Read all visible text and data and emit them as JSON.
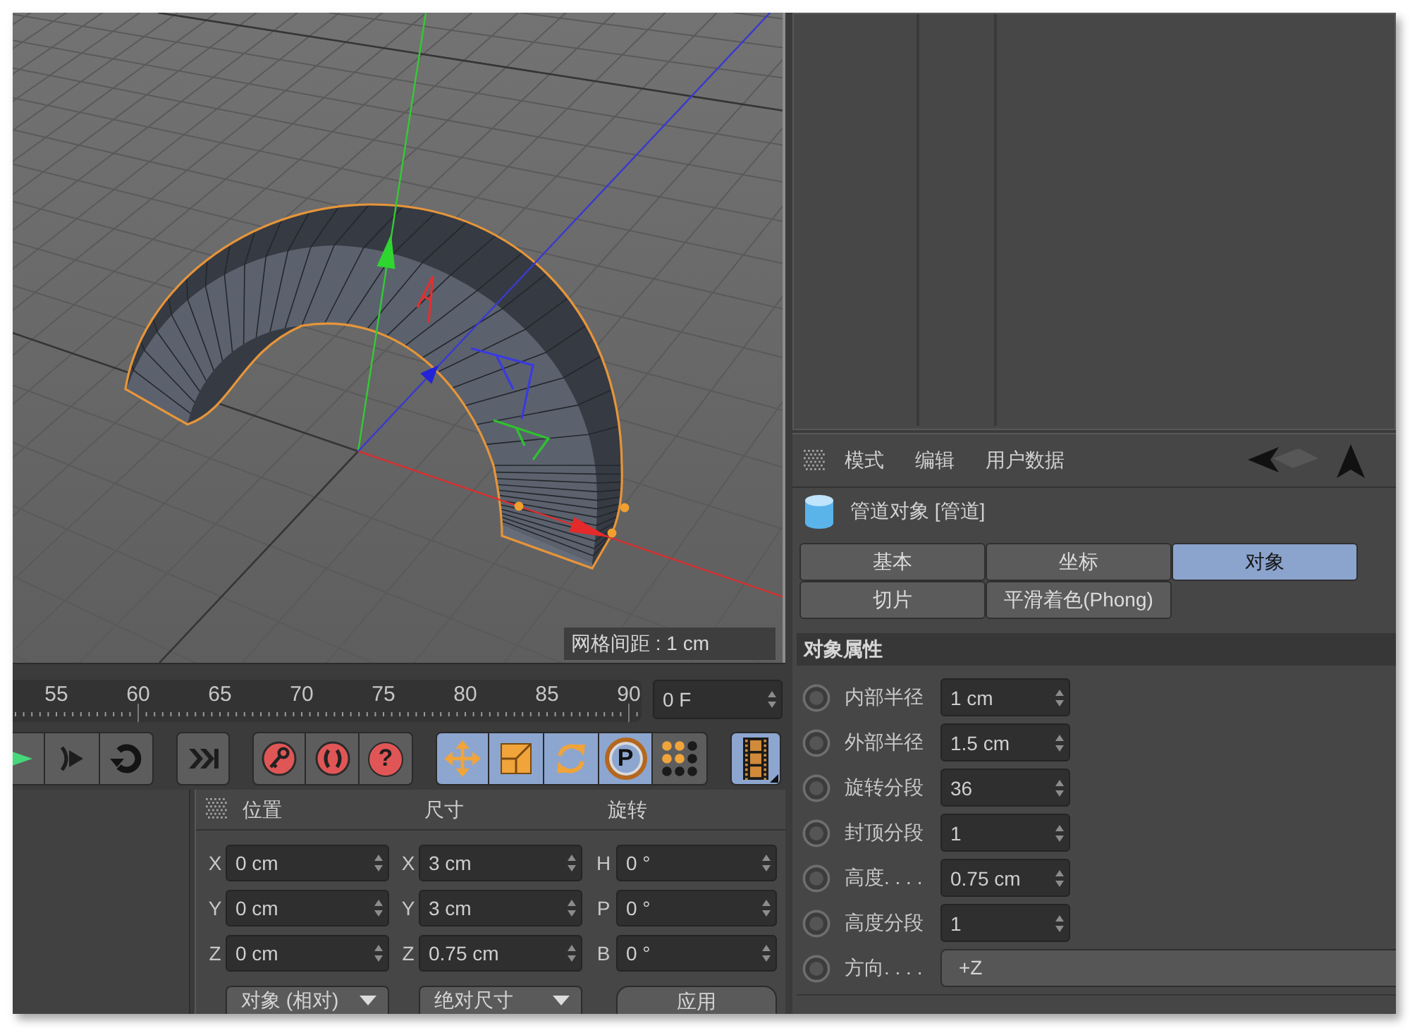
{
  "viewport": {
    "grid_label": "网格间距 : 1 cm"
  },
  "timeline": {
    "ruler_labels": [
      "55",
      "60",
      "65",
      "70",
      "75",
      "80",
      "85",
      "90"
    ],
    "frame": "0 F"
  },
  "toolbar": [
    {
      "buttons": [
        {
          "kind": "play",
          "active": false
        },
        {
          "kind": "next-frame",
          "active": false
        },
        {
          "kind": "loop",
          "active": false
        }
      ]
    },
    {
      "buttons": [
        {
          "kind": "go-to-end",
          "active": false
        }
      ]
    },
    {
      "buttons": [
        {
          "kind": "record",
          "active": false
        },
        {
          "kind": "autokey",
          "active": false
        },
        {
          "kind": "help",
          "active": false,
          "glyph": "?"
        }
      ]
    },
    {
      "buttons": [
        {
          "kind": "move",
          "active": true
        },
        {
          "kind": "scale",
          "active": true
        },
        {
          "kind": "rotate",
          "active": true
        },
        {
          "kind": "parameter",
          "active": true,
          "glyph": "P"
        },
        {
          "kind": "points",
          "active": false
        }
      ]
    },
    {
      "buttons": [
        {
          "kind": "film",
          "active": true
        }
      ]
    }
  ],
  "coordinates": {
    "headers": [
      "位置",
      "尺寸",
      "旋转"
    ],
    "rows": [
      {
        "cells": [
          {
            "axis": "X",
            "value": "0 cm"
          },
          {
            "axis": "X",
            "value": "3 cm"
          },
          {
            "axis": "H",
            "value": "0 °"
          }
        ]
      },
      {
        "cells": [
          {
            "axis": "Y",
            "value": "0 cm"
          },
          {
            "axis": "Y",
            "value": "3 cm"
          },
          {
            "axis": "P",
            "value": "0 °"
          }
        ]
      },
      {
        "cells": [
          {
            "axis": "Z",
            "value": "0 cm"
          },
          {
            "axis": "Z",
            "value": "0.75 cm"
          },
          {
            "axis": "B",
            "value": "0 °"
          }
        ]
      }
    ],
    "position_mode": "对象 (相对)",
    "size_mode": "绝对尺寸",
    "apply": "应用"
  },
  "attributes": {
    "menu": [
      "模式",
      "编辑",
      "用户数据"
    ],
    "object_title": "管道对象 [管道]",
    "tabs": [
      {
        "label": "基本",
        "selected": false
      },
      {
        "label": "坐标",
        "selected": false
      },
      {
        "label": "对象",
        "selected": true
      },
      {
        "label": "切片",
        "selected": false
      },
      {
        "label": "平滑着色(Phong)",
        "selected": false
      }
    ],
    "section": "对象属性",
    "properties": [
      {
        "kind": "number",
        "label": "内部半径",
        "value": "1 cm"
      },
      {
        "kind": "number",
        "label": "外部半径",
        "value": "1.5 cm"
      },
      {
        "kind": "number",
        "label": "旋转分段",
        "value": "36"
      },
      {
        "kind": "number",
        "label": "封顶分段",
        "value": "1"
      },
      {
        "kind": "number",
        "label": "高度. . . .",
        "value": "0.75 cm"
      },
      {
        "kind": "number",
        "label": "高度分段",
        "value": "1"
      },
      {
        "kind": "dropdown",
        "label": "方向. . . .",
        "value": "+Z"
      }
    ]
  }
}
